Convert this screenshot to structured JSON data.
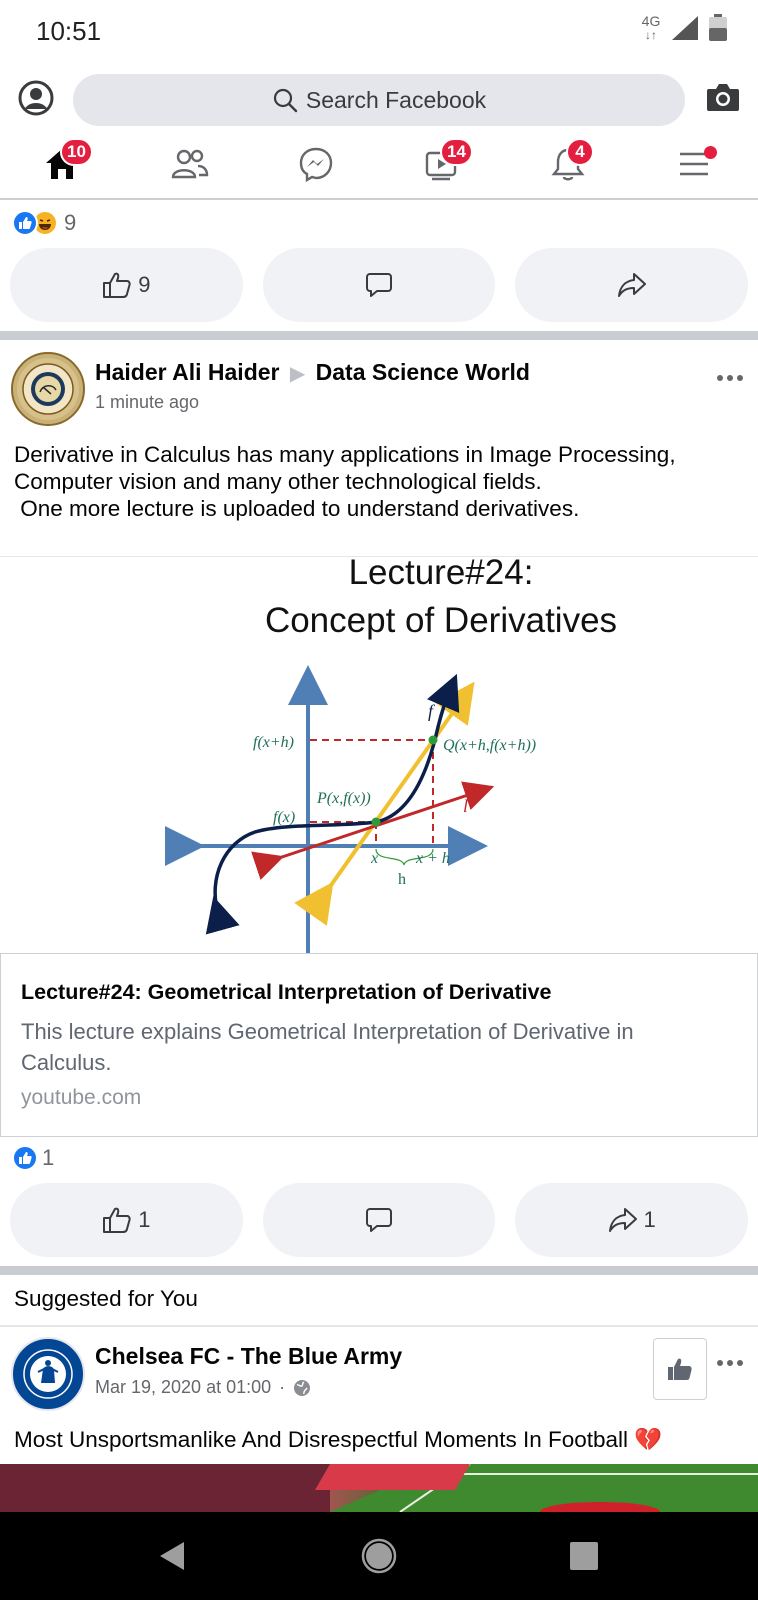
{
  "status_bar": {
    "time": "10:51",
    "network": "4G"
  },
  "top_bar": {
    "search_placeholder": "Search Facebook"
  },
  "nav": {
    "home_badge": "10",
    "watch_badge": "14",
    "notifications_badge": "4"
  },
  "colors": {
    "facebook_blue": "#1877f2",
    "badge_red": "#e41e3f",
    "chelsea_blue": "#034694"
  },
  "prev_post": {
    "reaction_count": "9",
    "like_count": "9"
  },
  "post": {
    "author": "Haider Ali Haider",
    "group": "Data Science World",
    "time": "1 minute ago",
    "text_lines": [
      "Derivative in Calculus has many applications in Image Processing,",
      "Computer vision and many other technological fields.",
      " One more lecture is uploaded to understand derivatives."
    ],
    "image": {
      "title_line1": "Lecture#24:",
      "title_line2": "Concept of Derivatives",
      "labels": {
        "fxh": "f(x+h)",
        "fx": "f(x)",
        "p": "P(x,f(x))",
        "q": "Q(x+h,f(x+h))",
        "f": "f",
        "l": "l",
        "x": "x",
        "xh": "x + h",
        "h": "h"
      }
    },
    "link": {
      "title": "Lecture#24: Geometrical Interpretation of Derivative",
      "description": "This lecture explains Geometrical Interpretation of Derivative in Calculus.",
      "domain": "youtube.com"
    },
    "reaction_count": "1",
    "like_count": "1",
    "share_count": "1"
  },
  "suggested": {
    "section_title": "Suggested for You",
    "page_name": "Chelsea FC - The Blue Army",
    "time": "Mar 19, 2020 at 01:00",
    "separator": "·",
    "text": "Most Unsportsmanlike And Disrespectful Moments In Football 💔"
  }
}
